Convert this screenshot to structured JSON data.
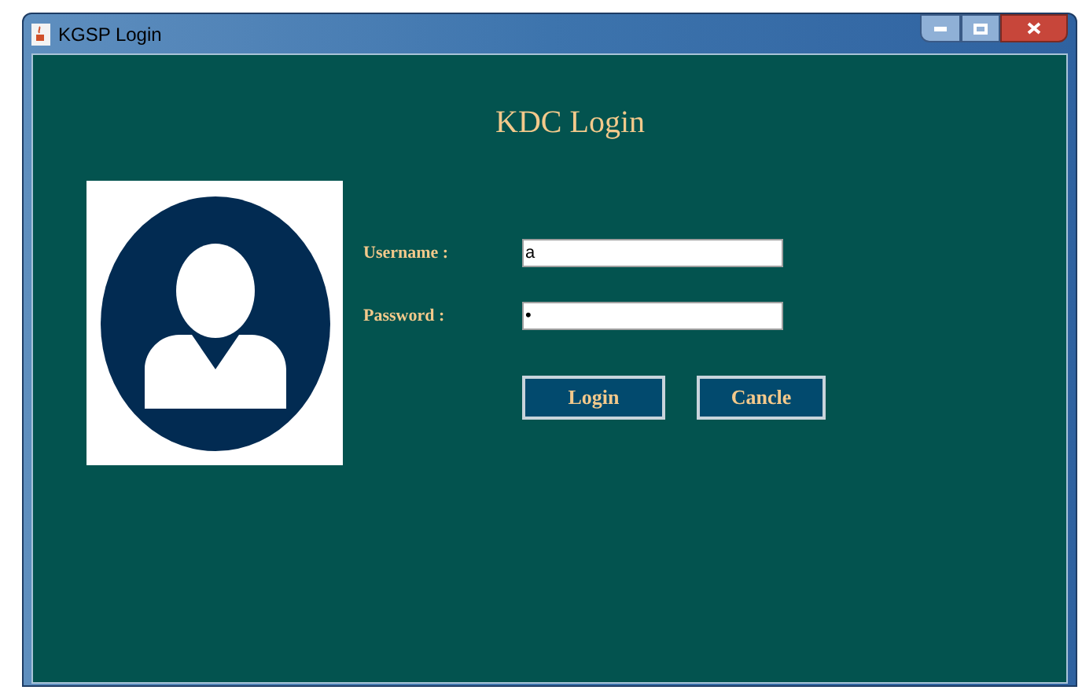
{
  "window": {
    "title": "KGSP Login"
  },
  "heading": "KDC Login",
  "fields": [
    {
      "label": "Username :",
      "value": "a"
    },
    {
      "label": "Password :",
      "value": "•"
    }
  ],
  "buttons": [
    "Login",
    "Cancle"
  ]
}
